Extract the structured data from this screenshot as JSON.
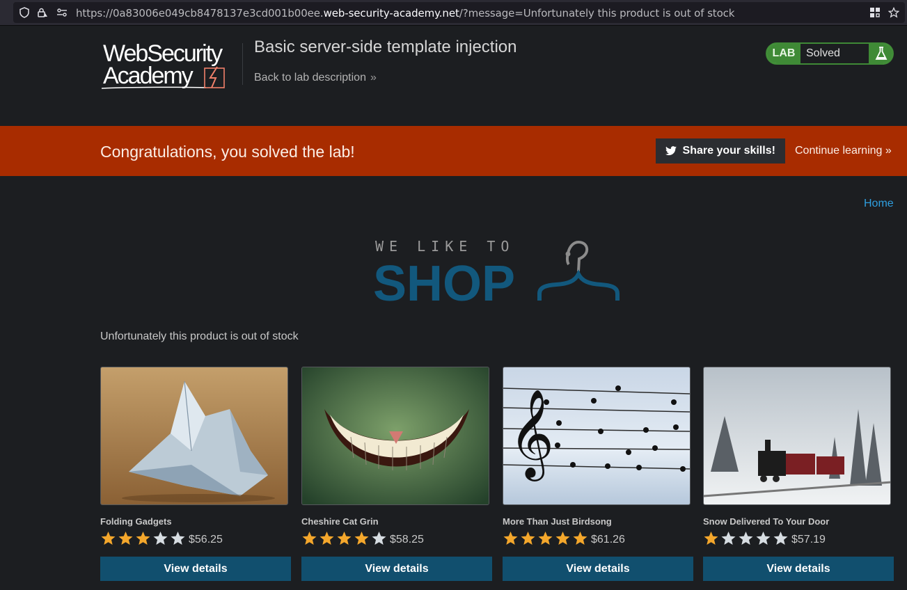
{
  "browser": {
    "url_prefix": "https://0a83006e049cb8478137e3cd001b00ee.",
    "url_host": "web-security-academy.net",
    "url_suffix": "/?message=Unfortunately this product is out of stock"
  },
  "header": {
    "logo_line1": "WebSecurity",
    "logo_line2": "Academy",
    "lab_title": "Basic server-side template injection",
    "back_link": "Back to lab description",
    "lab_badge": "LAB",
    "lab_status": "Solved"
  },
  "banner": {
    "message": "Congratulations, you solved the lab!",
    "share_label": "Share your skills!",
    "continue_label": "Continue learning"
  },
  "nav": {
    "home": "Home"
  },
  "shop_logo": {
    "tagline": "WE LIKE TO",
    "word": "SHOP"
  },
  "notice": "Unfortunately this product is out of stock",
  "products": [
    {
      "name": "Folding Gadgets",
      "rating": 3,
      "price": "$56.25",
      "button": "View details"
    },
    {
      "name": "Cheshire Cat Grin",
      "rating": 4,
      "price": "$58.25",
      "button": "View details"
    },
    {
      "name": "More Than Just Birdsong",
      "rating": 5,
      "price": "$61.26",
      "button": "View details"
    },
    {
      "name": "Snow Delivered To Your Door",
      "rating": 1,
      "price": "$57.19",
      "button": "View details"
    }
  ],
  "colors": {
    "banner": "#a82c00",
    "accent_blue": "#114f6e",
    "star_on": "#f4a72c",
    "star_off": "#d7dde2",
    "link": "#2f9fe0"
  }
}
